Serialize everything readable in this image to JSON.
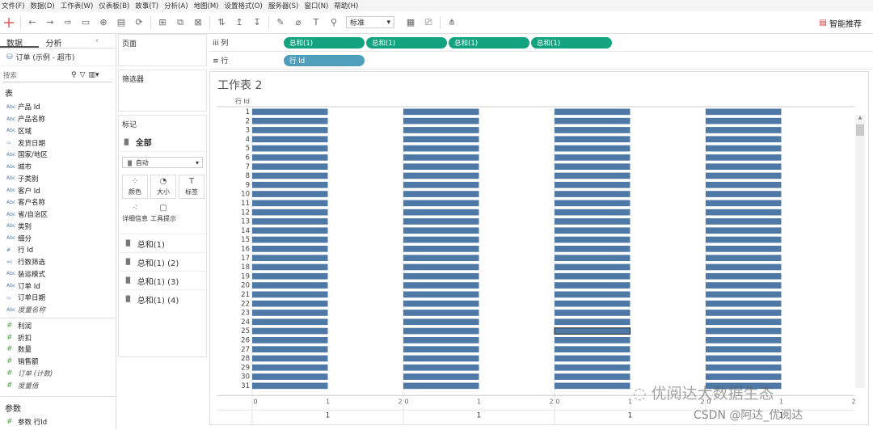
{
  "menu": [
    "文件(F)",
    "数据(D)",
    "工作表(W)",
    "仪表板(B)",
    "故事(T)",
    "分析(A)",
    "地图(M)",
    "设置格式(O)",
    "服务器(S)",
    "窗口(N)",
    "帮助(H)"
  ],
  "toolbar": {
    "fit_select": "标准",
    "smart_label": "智能推荐"
  },
  "left": {
    "tab_data": "数据",
    "tab_analysis": "分析",
    "collapse": "‹",
    "datasource": "订单 (示例 - 超市)",
    "search_placeholder": "搜索",
    "table_title": "表",
    "dimensions": [
      {
        "t": "Abc",
        "n": "产品 Id"
      },
      {
        "t": "Abc",
        "n": "产品名称"
      },
      {
        "t": "Abc",
        "n": "区域"
      },
      {
        "t": "cal",
        "n": "发货日期"
      },
      {
        "t": "Abc",
        "n": "国家/地区"
      },
      {
        "t": "Abc",
        "n": "城市"
      },
      {
        "t": "Abc",
        "n": "子类别"
      },
      {
        "t": "Abc",
        "n": "客户 Id"
      },
      {
        "t": "Abc",
        "n": "客户名称"
      },
      {
        "t": "Abc",
        "n": "省/自治区"
      },
      {
        "t": "Abc",
        "n": "类别"
      },
      {
        "t": "Abc",
        "n": "细分"
      },
      {
        "t": "#",
        "n": "行 Id"
      },
      {
        "t": "=|",
        "n": "行数筛选"
      },
      {
        "t": "Abc",
        "n": "装运模式"
      },
      {
        "t": "Abc",
        "n": "订单 Id"
      },
      {
        "t": "cal",
        "n": "订单日期"
      },
      {
        "t": "Abc",
        "n": "度量名称",
        "it": true
      }
    ],
    "measures": [
      {
        "n": "利润"
      },
      {
        "n": "折扣"
      },
      {
        "n": "数量"
      },
      {
        "n": "销售额"
      },
      {
        "n": "订单 (计数)",
        "it": true
      },
      {
        "n": "度量值",
        "it": true
      }
    ],
    "params_title": "参数",
    "params": [
      {
        "n": "参数 行Id"
      }
    ]
  },
  "cards": {
    "pages": "页面",
    "filters": "筛选器",
    "marks": "标记",
    "marks_all": "全部",
    "mark_type": "自动",
    "buttons": [
      "颜色",
      "大小",
      "标签",
      "详细信息",
      "工具提示"
    ],
    "sums": [
      "总和(1)",
      "总和(1) (2)",
      "总和(1) (3)",
      "总和(1) (4)"
    ]
  },
  "shelves": {
    "columns_label": "列",
    "rows_label": "行",
    "column_pills": [
      "总和(1)",
      "总和(1)",
      "总和(1)",
      "总和(1)"
    ],
    "row_pills": [
      "行 Id"
    ]
  },
  "sheet_title": "工作表 2",
  "chart_data": {
    "type": "bar",
    "orientation": "horizontal",
    "row_header": "行 Id",
    "rows": [
      1,
      2,
      3,
      4,
      5,
      6,
      7,
      8,
      9,
      10,
      11,
      12,
      13,
      14,
      15,
      16,
      17,
      18,
      19,
      20,
      21,
      22,
      23,
      24,
      25,
      26,
      27,
      28,
      29,
      30,
      31
    ],
    "panes": [
      {
        "measure": "总和(1)",
        "values": [
          1,
          1,
          1,
          1,
          1,
          1,
          1,
          1,
          1,
          1,
          1,
          1,
          1,
          1,
          1,
          1,
          1,
          1,
          1,
          1,
          1,
          1,
          1,
          1,
          1,
          1,
          1,
          1,
          1,
          1,
          1
        ],
        "xlim": [
          0,
          2
        ],
        "ticks": [
          "0",
          "1",
          "2"
        ],
        "footer": "1"
      },
      {
        "measure": "总和(1)",
        "values": [
          1,
          1,
          1,
          1,
          1,
          1,
          1,
          1,
          1,
          1,
          1,
          1,
          1,
          1,
          1,
          1,
          1,
          1,
          1,
          1,
          1,
          1,
          1,
          1,
          1,
          1,
          1,
          1,
          1,
          1,
          1
        ],
        "xlim": [
          0,
          2
        ],
        "ticks": [
          "0",
          "1",
          "2"
        ],
        "footer": "1"
      },
      {
        "measure": "总和(1)",
        "values": [
          1,
          1,
          1,
          1,
          1,
          1,
          1,
          1,
          1,
          1,
          1,
          1,
          1,
          1,
          1,
          1,
          1,
          1,
          1,
          1,
          1,
          1,
          1,
          1,
          1,
          1,
          1,
          1,
          1,
          1,
          1
        ],
        "xlim": [
          0,
          2
        ],
        "ticks": [
          "0",
          "1",
          "2"
        ],
        "footer": "1"
      },
      {
        "measure": "总和(1)",
        "values": [
          1,
          1,
          1,
          1,
          1,
          1,
          1,
          1,
          1,
          1,
          1,
          1,
          1,
          1,
          1,
          1,
          1,
          1,
          1,
          1,
          1,
          1,
          1,
          1,
          1,
          1,
          1,
          1,
          1,
          1,
          1
        ],
        "xlim": [
          0,
          2
        ],
        "ticks": [
          "0",
          "1",
          "2"
        ],
        "footer": "1"
      }
    ],
    "bar_color": "#4e79a7",
    "highlighted_row": 25,
    "highlighted_pane": 2
  },
  "watermark": {
    "line1": "优阅达大数据生态",
    "line2": "CSDN @阿达_优阅达"
  }
}
